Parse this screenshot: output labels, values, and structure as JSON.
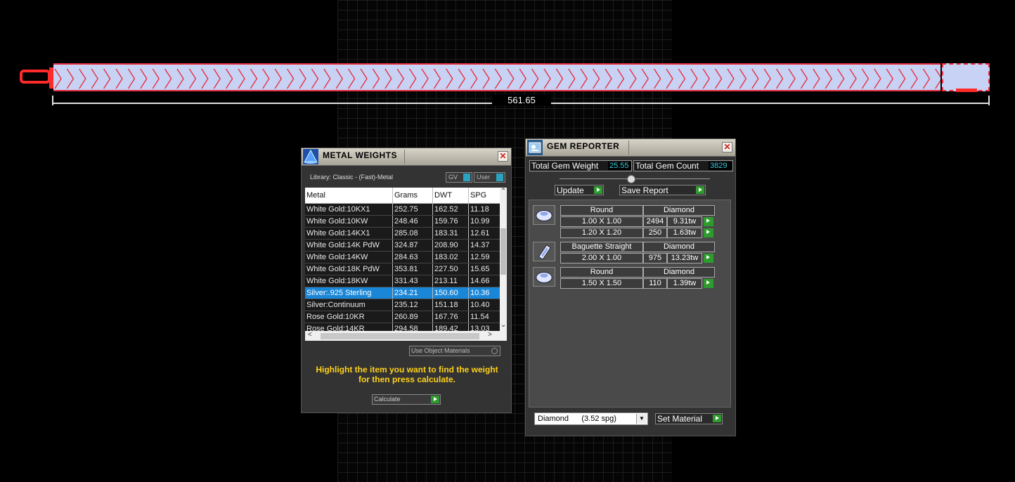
{
  "viewport": {
    "dimension_label": "561.65"
  },
  "metal_weights": {
    "title": "METAL WEIGHTS",
    "close": "✕",
    "library_label": "Library: Classic - (Fast)-Metal",
    "toggle_gv": "GV",
    "toggle_user": "User",
    "columns": [
      "Metal",
      "Grams",
      "DWT",
      "SPG"
    ],
    "rows": [
      [
        "White Gold:10KX1",
        "252.75",
        "162.52",
        "11.18"
      ],
      [
        "White Gold:10KW",
        "248.46",
        "159.76",
        "10.99"
      ],
      [
        "White Gold:14KX1",
        "285.08",
        "183.31",
        "12.61"
      ],
      [
        "White Gold:14K PdW",
        "324.87",
        "208.90",
        "14.37"
      ],
      [
        "White Gold:14KW",
        "284.63",
        "183.02",
        "12.59"
      ],
      [
        "White Gold:18K PdW",
        "353.81",
        "227.50",
        "15.65"
      ],
      [
        "White Gold:18KW",
        "331.43",
        "213.11",
        "14.66"
      ],
      [
        "Silver:.925 Sterling",
        "234.21",
        "150.60",
        "10.36"
      ],
      [
        "Silver:Continuum",
        "235.12",
        "151.18",
        "10.40"
      ],
      [
        "Rose Gold:10KR",
        "260.89",
        "167.76",
        "11.54"
      ],
      [
        "Rose Gold:14KR",
        "294.58",
        "189.42",
        "13.03"
      ]
    ],
    "selected_row": 7,
    "use_object_materials": "Use Object Materials",
    "hint_line1": "Highlight the item you want to find the weight",
    "hint_line2": "for then press calculate.",
    "calculate": "Calculate"
  },
  "gem_reporter": {
    "title": "GEM REPORTER",
    "close": "✕",
    "total_weight_label": "Total Gem Weight",
    "total_weight_value": "25.55",
    "total_count_label": "Total Gem Count",
    "total_count_value": "3829",
    "update": "Update",
    "save_report": "Save Report",
    "groups": [
      {
        "shape": "Round",
        "material": "Diamond",
        "icon": "round-gem-icon",
        "rows": [
          [
            "1.00 X 1.00",
            "2494",
            "9.31tw"
          ],
          [
            "1.20 X 1.20",
            "250",
            "1.63tw"
          ]
        ]
      },
      {
        "shape": "Baguette Straight",
        "material": "Diamond",
        "icon": "baguette-gem-icon",
        "rows": [
          [
            "2.00 X 1.00",
            "975",
            "13.23tw"
          ]
        ]
      },
      {
        "shape": "Round",
        "material": "Diamond",
        "icon": "round-gem-icon",
        "rows": [
          [
            "1.50 X 1.50",
            "110",
            "1.39tw"
          ]
        ]
      }
    ],
    "material_select": "Diamond      (3.52 spg)",
    "set_material": "Set Material"
  },
  "colors": {
    "highlight": "#1a86d8",
    "hint": "#ffd21a",
    "accent_green": "#2e9b2e",
    "value_cyan": "#36d0e0",
    "outline_red": "#ff2a2a"
  }
}
